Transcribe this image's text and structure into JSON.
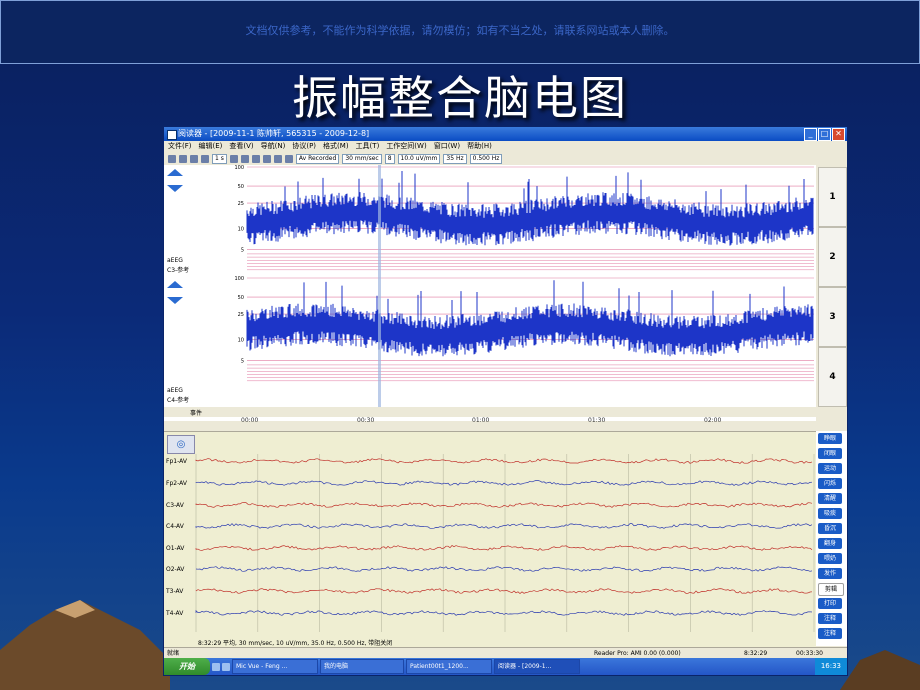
{
  "banner": {
    "text": "文档仅供参考，不能作为科学依据，请勿模仿；如有不当之处，请联系网站或本人删除。"
  },
  "slide": {
    "title": "振幅整合脑电图"
  },
  "window": {
    "title": "阅读器 - [2009-11-1 陈帅轩, 565315 - 2009-12-8]",
    "buttons": {
      "minimize": "_",
      "maximize": "□",
      "close": "✕"
    }
  },
  "menu": {
    "items": [
      "文件(F)",
      "编辑(E)",
      "查看(V)",
      "导航(N)",
      "协议(P)",
      "格式(M)",
      "工具(T)",
      "工作空间(W)",
      "窗口(W)",
      "帮助(H)"
    ]
  },
  "toolbar": {
    "zoom": "1 s",
    "montage": "Av Recorded",
    "speed": "30 mm/sec",
    "channels": "8",
    "sensitivity": "10.0 uV/mm",
    "lowpass": "35 Hz",
    "highpass": "0.500 Hz"
  },
  "trend": {
    "panel1": {
      "scale": [
        "100",
        "50",
        "25",
        "10",
        "5"
      ],
      "label1": "aEEG",
      "label2": "C3-参考"
    },
    "panel2": {
      "scale": [
        "100",
        "50",
        "25",
        "10",
        "5"
      ],
      "label1": "aEEG",
      "label2": "C4-参考"
    },
    "pages": [
      "1",
      "2",
      "3",
      "4"
    ],
    "event_label": "事件",
    "time_ticks": [
      "00:00",
      "00:30",
      "01:00",
      "01:30",
      "02:00"
    ]
  },
  "eeg": {
    "channels": [
      "Fp1-AV",
      "Fp2-AV",
      "C3-AV",
      "C4-AV",
      "O1-AV",
      "O2-AV",
      "T3-AV",
      "T4-AV"
    ],
    "status": "8:32:29 平均, 30 mm/sec, 10 uV/mm, 35.0 Hz, 0.500 Hz, 带阻关闭"
  },
  "side_buttons": [
    "睁眼",
    "闭眼",
    "运动",
    "闪烁",
    "清醒",
    "吸痰",
    "昏沉",
    "翻身",
    "喂奶",
    "发作",
    "剪辑",
    "打印",
    "注释",
    "注释"
  ],
  "status_bar": {
    "left": "就绪",
    "center": "Reader Pro: AMI 0.00 (0.000)",
    "time1": "8:32:29",
    "time2": "00:33:30"
  },
  "taskbar": {
    "start": "开始",
    "items": [
      "Mic Vue - Feng ...",
      "我的电脑",
      "Patient00t1_1200...",
      "阅读器 - [2009-1..."
    ],
    "clock": "16:33"
  }
}
